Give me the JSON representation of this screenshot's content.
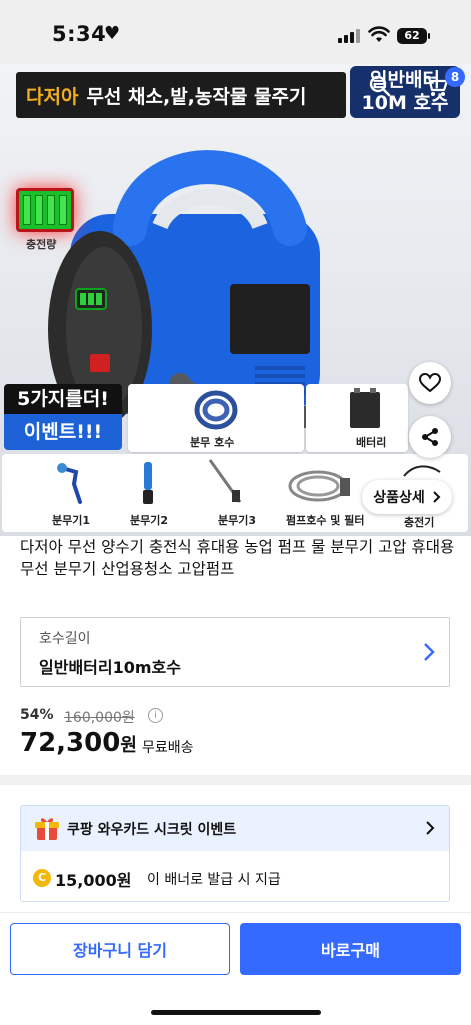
{
  "status": {
    "time": "5:34",
    "battery": "62"
  },
  "colors": {
    "accent": "#346aff",
    "brand_yellow": "#f2b01e",
    "navy": "#15306a",
    "promo_blue": "#1c62d6"
  },
  "hero": {
    "banner_brand": "다저아",
    "banner_text": "무선 채소,밭,농작물 물주기",
    "banner_right_line1": "일반배터",
    "banner_right_line2": "10M 호수",
    "cart_count": "8",
    "charge_label": "충전량",
    "promo_line1": "5가지를더!",
    "promo_line2": "이벤트!!!",
    "accessory_top": [
      "분무 호수",
      "배터리"
    ],
    "accessory_bottom": [
      "분무기1",
      "분무기2",
      "분무기3",
      "펌프호수 및 필터",
      "충전기"
    ],
    "detail_button": "상품상세",
    "icons": [
      "search-icon",
      "cart-icon",
      "heart-icon",
      "share-icon"
    ]
  },
  "product": {
    "title": "다저아 무선 양수기 충전식 휴대용 농업 펌프 물 분무기 고압 휴대용 무선 분무기 산업용청소 고압펌프",
    "option_label": "호수길이",
    "option_value": "일반배터리10m호수",
    "discount": "54%",
    "original_price": "160,000원",
    "price": "72,300",
    "price_unit": "원",
    "shipping": "무료배송"
  },
  "wow_card": {
    "title": "쿠팡 와우카드 시크릿 이벤트",
    "coin": "C",
    "amount": "15,000원",
    "desc": "이 배너로 발급 시 지급"
  },
  "bottom": {
    "cart_button": "장바구니 담기",
    "buy_button": "바로구매"
  }
}
